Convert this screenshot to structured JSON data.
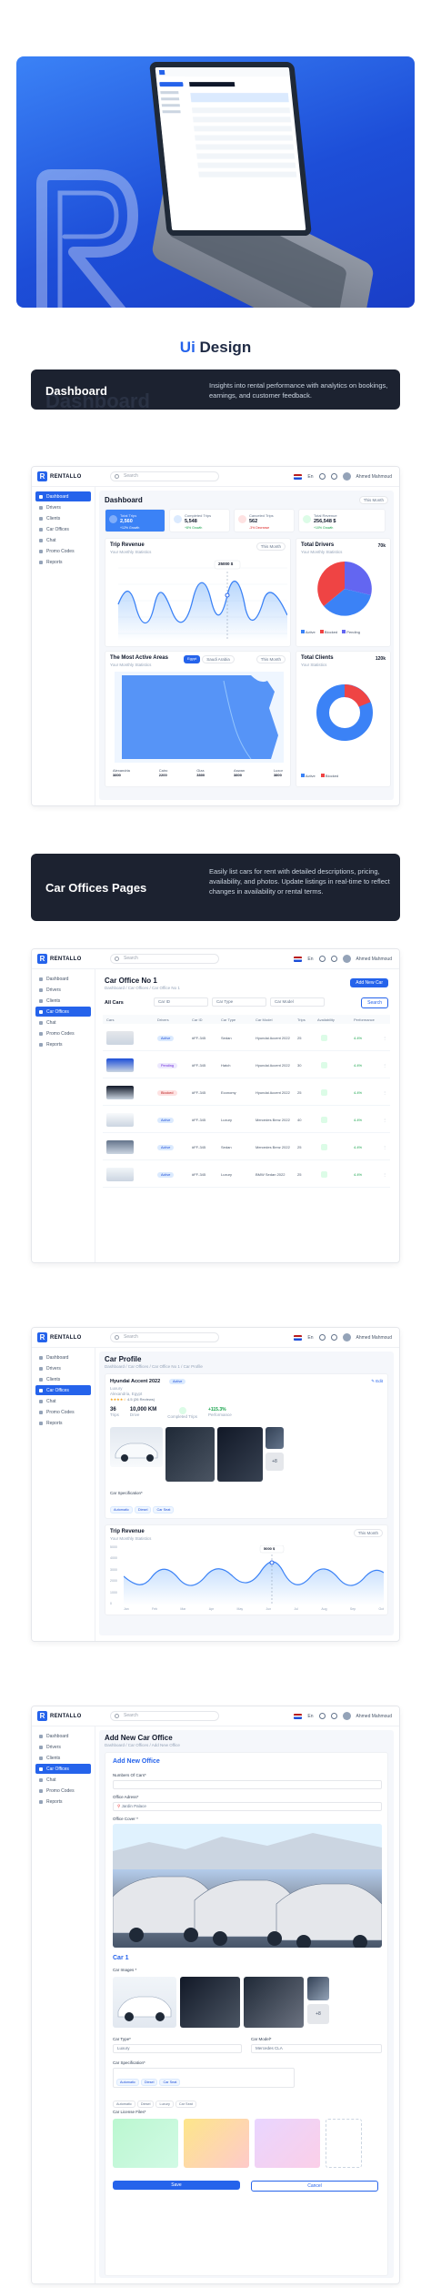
{
  "section_title": {
    "prefix": "Ui",
    "rest": " Design"
  },
  "banners": {
    "dashboard": {
      "title": "Dashboard",
      "ghost": "Dashboard",
      "desc": "Insights into rental performance with analytics on bookings, earnings, and customer feedback."
    },
    "car_offices": {
      "title": "Car Offices Pages",
      "desc": "Easily list cars for rent with detailed descriptions, pricing, availability, and photos. Update listings in real-time to reflect changes in availability or rental terms."
    }
  },
  "brand": {
    "name": "RENTALLO",
    "mark": "R"
  },
  "topbar": {
    "search_placeholder": "Search",
    "lang": "En",
    "user": "Ahmed Mahmoud"
  },
  "sidebar": {
    "items": [
      "Dashboard",
      "Drivers",
      "Clients",
      "Car Offices",
      "Chat",
      "Promo Codes",
      "Reports"
    ]
  },
  "dashboard": {
    "title": "Dashboard",
    "filter": "This Month",
    "stats": [
      {
        "label": "Total Trips",
        "value": "2,560",
        "change": "+12% Growth"
      },
      {
        "label": "Completed Trips",
        "value": "5,548",
        "change": "+8% Growth"
      },
      {
        "label": "Canceled Trips",
        "value": "562",
        "change": "-3% Decrease"
      },
      {
        "label": "Total Revenue",
        "value": "256,548 $",
        "change": "+10% Growth"
      }
    ],
    "trip_revenue": {
      "title": "Trip Revenue",
      "sub": "Your Monthly Statistics",
      "filter": "This Month",
      "tooltip": "25000 $"
    },
    "total_drivers": {
      "title": "Total Drivers",
      "sub": "Your Monthly Statistics",
      "count": "70k",
      "legend": [
        "Active",
        "Blocked",
        "Pending"
      ]
    },
    "active_areas": {
      "title": "The Most Active Areas",
      "sub": "Your Monthly Statistics",
      "tabs": [
        "Egypt",
        "Saudi Arabia"
      ],
      "filter": "This Month",
      "areas": [
        {
          "name": "Alexandria",
          "value": "3800"
        },
        {
          "name": "Cairo",
          "value": "2200"
        },
        {
          "name": "Giza",
          "value": "3800"
        },
        {
          "name": "Aswan",
          "value": "3800"
        },
        {
          "name": "Luxor",
          "value": "3800"
        }
      ]
    },
    "total_clients": {
      "title": "Total Clients",
      "sub": "Your Statistics",
      "count": "120k",
      "legend": [
        "Active",
        "Blocked"
      ]
    }
  },
  "car_office": {
    "title": "Car Office No 1",
    "breadcrumb": "Dashboard  /  Car Offices  /  Car Office No 1",
    "add_button": "Add New Car",
    "filter_label": "All Cars",
    "filters": [
      "Car ID",
      "Car Type",
      "Car Model"
    ],
    "search_button": "Search",
    "columns": [
      "Cars",
      "Drivers",
      "Car ID",
      "Car Type",
      "Car Model",
      "Trips",
      "Availability",
      "Performance"
    ],
    "rows": [
      {
        "driver": "Active",
        "status": "blue",
        "id": "#FF-345",
        "type": "Sedan",
        "model": "Hyundai Accent 2022",
        "trips": "25",
        "perf": "4.4%"
      },
      {
        "driver": "Pending",
        "status": "purple",
        "id": "#FF-345",
        "type": "Hatch",
        "model": "Hyundai Accent 2022",
        "trips": "30",
        "perf": "4.4%"
      },
      {
        "driver": "Blocked",
        "status": "red",
        "id": "#FF-345",
        "type": "Economy",
        "model": "Hyundai Accent 2022",
        "trips": "25",
        "perf": "4.4%"
      },
      {
        "driver": "Active",
        "status": "blue",
        "id": "#FF-345",
        "type": "Luxury",
        "model": "Mercedes Benz 2022",
        "trips": "40",
        "perf": "4.4%"
      },
      {
        "driver": "Active",
        "status": "blue",
        "id": "#FF-345",
        "type": "Sedan",
        "model": "Mercedes Benz 2022",
        "trips": "25",
        "perf": "4.4%"
      },
      {
        "driver": "Active",
        "status": "blue",
        "id": "#FF-345",
        "type": "Luxury",
        "model": "BMW Sedan 2022",
        "trips": "25",
        "perf": "4.4%"
      }
    ]
  },
  "car_profile": {
    "title": "Car Profile",
    "breadcrumb": "Dashboard  /  Car Offices  /  Car Office No 1  /  Car Profile",
    "car_name": "Hyundai Accent 2022",
    "badge": "Active",
    "sub": "Luxury",
    "location": "Alexandria, Egypt",
    "rating": "4.5 (26 Reviews)",
    "edit": "Edit",
    "metrics": [
      {
        "v": "36",
        "l": "Trips"
      },
      {
        "v": "10,000 KM",
        "l": "Drive"
      },
      {
        "v": "",
        "l": "Completed Trips"
      },
      {
        "v": "+115.3%",
        "l": "Performance"
      }
    ],
    "more_photos": "+8",
    "spec_label": "Car Specification*",
    "specs": [
      "Automatic",
      "Diesel",
      "Car Seat"
    ],
    "revenue_title": "Trip Revenue",
    "revenue_sub": "Your Monthly Statistics",
    "revenue_filter": "This Month",
    "tooltip": "5000 $",
    "months": [
      "Jan",
      "Feb",
      "Mar",
      "Apr",
      "May",
      "Jun",
      "Jul",
      "Aug",
      "Sep",
      "Oct"
    ],
    "yticks": [
      "5000",
      "4000",
      "3000",
      "2000",
      "1000",
      "0"
    ]
  },
  "add_office": {
    "title": "Add New Car Office",
    "breadcrumb": "Dashboard  /  Car Offices  /  Add New Office",
    "form_title": "Add New Office",
    "f_number": "Numbers Of Cars*",
    "f_number_val": "",
    "f_address": "Office Adress*",
    "f_address_val": "Jardin Palace",
    "f_cover": "Office Cover *",
    "car_heading": "Car 1",
    "car_images": "Car Images *",
    "more_photos": "+8",
    "car_type": "Car Type*",
    "car_type_val": "Luxury",
    "car_model": "Car Model*",
    "car_model_val": "Mercedes CLA",
    "car_spec": "Car Specification*",
    "specs": [
      "Automatic",
      "Diesel",
      "Car Seat"
    ],
    "spec_options": [
      "Automatic",
      "Diesel",
      "Luxury",
      "Car Seat"
    ],
    "license": "Car License Files*",
    "save": "Save",
    "cancel": "Cancel"
  },
  "colors": {
    "accent": "#2563eb",
    "dark": "#1c2230",
    "pie_active": "#3b82f6",
    "pie_blocked": "#ef4444",
    "pie_pending": "#6366f1"
  }
}
